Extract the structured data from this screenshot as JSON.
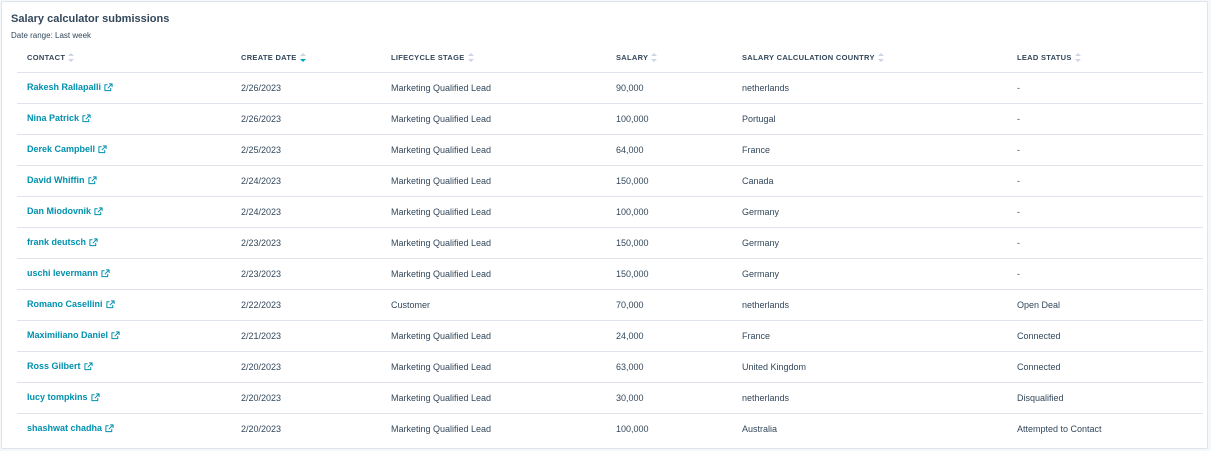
{
  "report": {
    "title": "Salary calculator submissions",
    "date_range": "Date range: Last week"
  },
  "colors": {
    "link": "#0091ae",
    "sort_active": "#00a4bd",
    "border": "#dfe3eb",
    "text": "#33475b"
  },
  "columns": [
    {
      "label": "CONTACT",
      "sorted": false
    },
    {
      "label": "CREATE DATE",
      "sorted": true
    },
    {
      "label": "LIFECYCLE STAGE",
      "sorted": false
    },
    {
      "label": "SALARY",
      "sorted": false
    },
    {
      "label": "SALARY CALCULATION COUNTRY",
      "sorted": false
    },
    {
      "label": "LEAD STATUS",
      "sorted": false
    }
  ],
  "rows": [
    {
      "contact": "Rakesh Rallapalli",
      "create_date": "2/26/2023",
      "lifecycle_stage": "Marketing Qualified Lead",
      "salary": "90,000",
      "country": "netherlands",
      "lead_status": "-"
    },
    {
      "contact": "Nina Patrick",
      "create_date": "2/26/2023",
      "lifecycle_stage": "Marketing Qualified Lead",
      "salary": "100,000",
      "country": "Portugal",
      "lead_status": "-"
    },
    {
      "contact": "Derek Campbell",
      "create_date": "2/25/2023",
      "lifecycle_stage": "Marketing Qualified Lead",
      "salary": "64,000",
      "country": "France",
      "lead_status": "-"
    },
    {
      "contact": "David Whiffin",
      "create_date": "2/24/2023",
      "lifecycle_stage": "Marketing Qualified Lead",
      "salary": "150,000",
      "country": "Canada",
      "lead_status": "-"
    },
    {
      "contact": "Dan Miodovnik",
      "create_date": "2/24/2023",
      "lifecycle_stage": "Marketing Qualified Lead",
      "salary": "100,000",
      "country": "Germany",
      "lead_status": "-"
    },
    {
      "contact": "frank deutsch",
      "create_date": "2/23/2023",
      "lifecycle_stage": "Marketing Qualified Lead",
      "salary": "150,000",
      "country": "Germany",
      "lead_status": "-"
    },
    {
      "contact": "uschi levermann",
      "create_date": "2/23/2023",
      "lifecycle_stage": "Marketing Qualified Lead",
      "salary": "150,000",
      "country": "Germany",
      "lead_status": "-"
    },
    {
      "contact": "Romano Casellini",
      "create_date": "2/22/2023",
      "lifecycle_stage": "Customer",
      "salary": "70,000",
      "country": "netherlands",
      "lead_status": "Open Deal"
    },
    {
      "contact": "Maximiliano Daniel",
      "create_date": "2/21/2023",
      "lifecycle_stage": "Marketing Qualified Lead",
      "salary": "24,000",
      "country": "France",
      "lead_status": "Connected"
    },
    {
      "contact": "Ross Gilbert",
      "create_date": "2/20/2023",
      "lifecycle_stage": "Marketing Qualified Lead",
      "salary": "63,000",
      "country": "United Kingdom",
      "lead_status": "Connected"
    },
    {
      "contact": "lucy tompkins",
      "create_date": "2/20/2023",
      "lifecycle_stage": "Marketing Qualified Lead",
      "salary": "30,000",
      "country": "netherlands",
      "lead_status": "Disqualified"
    },
    {
      "contact": "shashwat chadha",
      "create_date": "2/20/2023",
      "lifecycle_stage": "Marketing Qualified Lead",
      "salary": "100,000",
      "country": "Australia",
      "lead_status": "Attempted to Contact"
    }
  ]
}
